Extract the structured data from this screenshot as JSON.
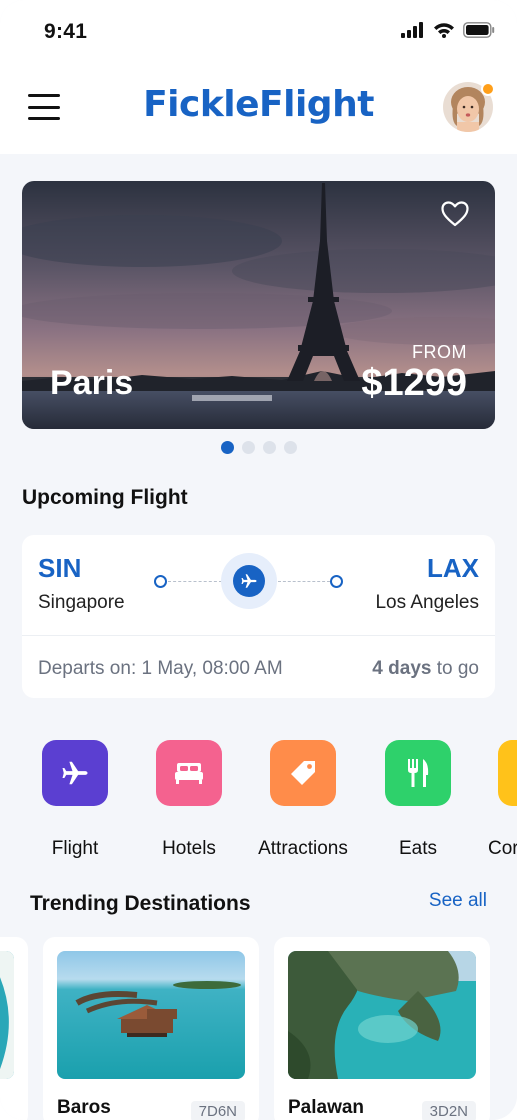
{
  "status": {
    "time": "9:41"
  },
  "header": {
    "logo": "FickleFlight"
  },
  "hero": {
    "city": "Paris",
    "from_label": "FROM",
    "price": "$1299"
  },
  "carousel": {
    "pages": 4,
    "active": 1
  },
  "upcoming": {
    "title": "Upcoming Flight",
    "from_code": "SIN",
    "from_city": "Singapore",
    "to_code": "LAX",
    "to_city": "Los Angeles",
    "departs": "Departs on: 1 May, 08:00 AM",
    "days": "4 days",
    "to_go": "to go"
  },
  "categories": [
    {
      "label": "Flight",
      "color": "#5b3fd1",
      "icon": "plane-icon"
    },
    {
      "label": "Hotels",
      "color": "#f4628f",
      "icon": "bed-icon"
    },
    {
      "label": "Attractions",
      "color": "#ff8c4a",
      "icon": "tag-icon"
    },
    {
      "label": "Eats",
      "color": "#2ed16b",
      "icon": "cutlery-icon"
    },
    {
      "label": "Cor",
      "color": "#ffc21a",
      "icon": "generic-icon"
    }
  ],
  "trending": {
    "title": "Trending Destinations",
    "see_all": "See all",
    "items": [
      {
        "name": "Baros",
        "tag": "7D6N"
      },
      {
        "name": "Palawan",
        "tag": "3D2N"
      }
    ]
  },
  "colors": {
    "accent": "#1863c4",
    "badge": "#ff9f1a"
  }
}
